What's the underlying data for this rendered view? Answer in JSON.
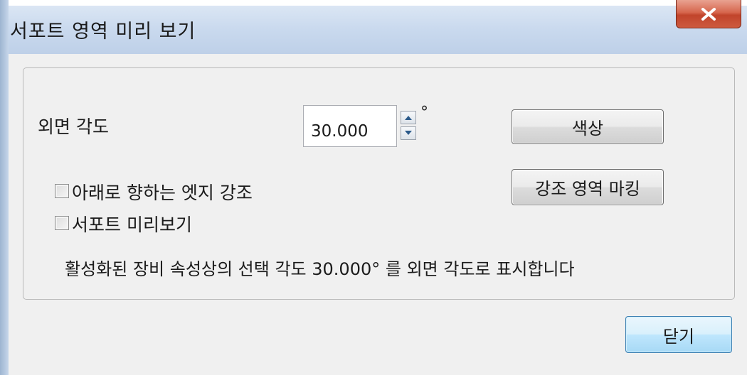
{
  "window": {
    "title": "서포트 영역 미리 보기"
  },
  "angle": {
    "label": "외면 각도",
    "value": "30.000",
    "unit": "°"
  },
  "buttons": {
    "color": "색상",
    "mark_highlight": "강조 영역 마킹",
    "close": "닫기"
  },
  "checkboxes": [
    {
      "label": "아래로 향하는 엣지 강조",
      "checked": false
    },
    {
      "label": "서포트 미리보기",
      "checked": false
    }
  ],
  "info_text": "활성화된 장비 속성상의 선택 각도 30.000° 를 외면 각도로 표시합니다",
  "icons": {
    "close": "close-icon",
    "spin_up": "up-arrow-icon",
    "spin_down": "down-arrow-icon"
  },
  "colors": {
    "close_button": "#c1442b",
    "default_button_border": "#3c7fb1",
    "titlebar": "#c9d9ee",
    "client_background": "#f0f0f0"
  }
}
